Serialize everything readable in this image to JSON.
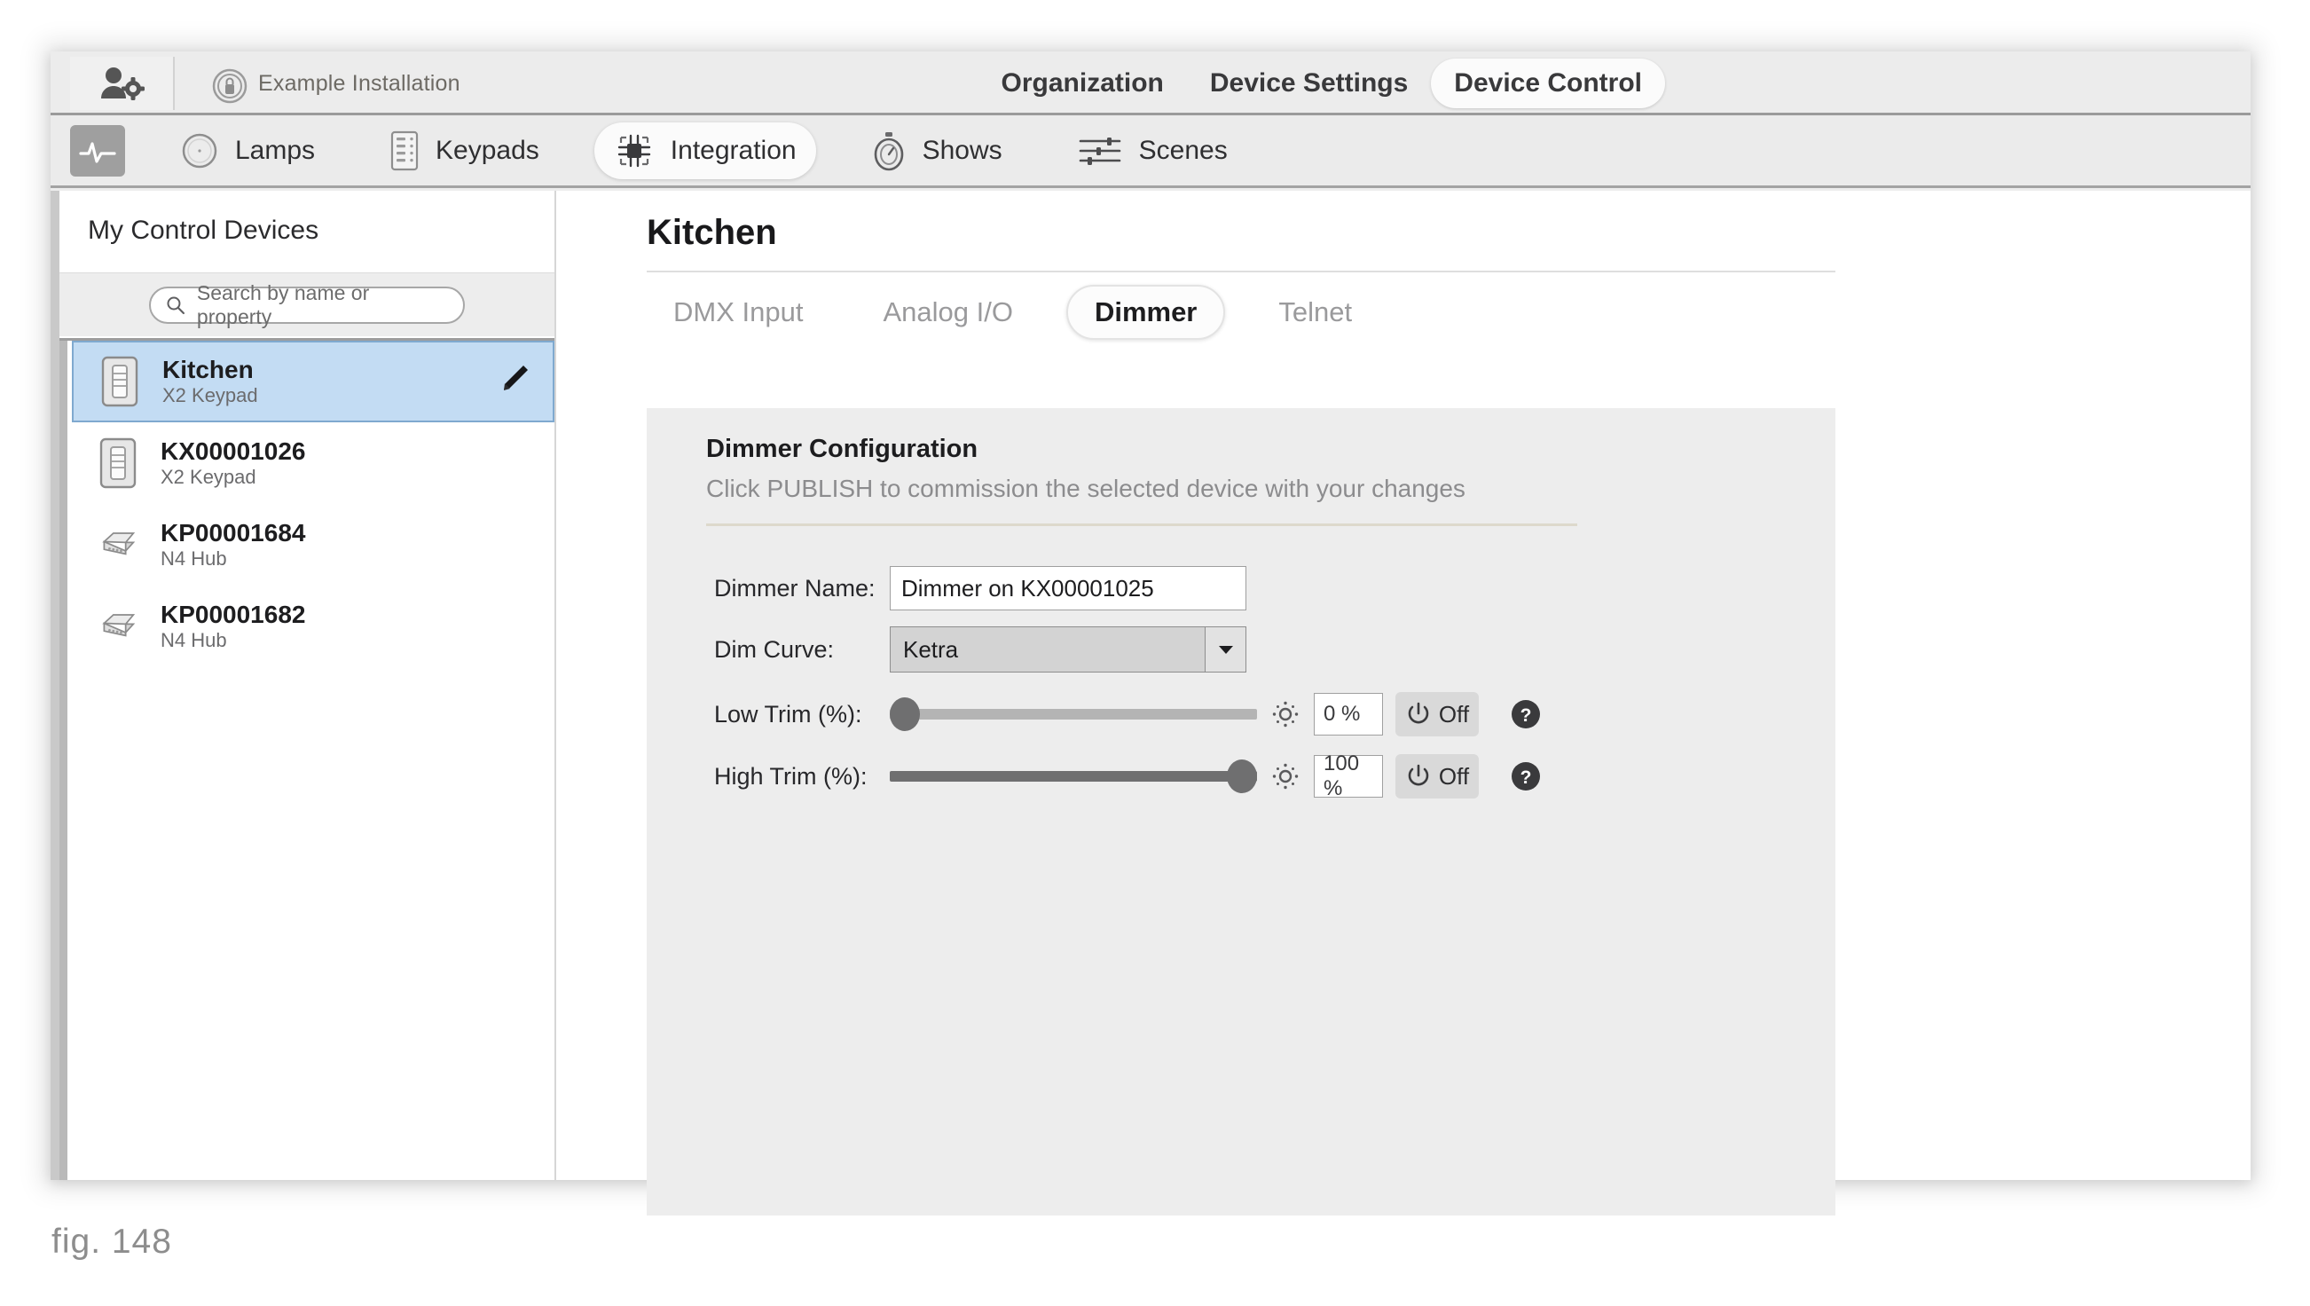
{
  "window": {
    "topbar": {
      "user_settings_icon": "user-gear-icon",
      "installation_lock_icon": "lock-ring-icon",
      "installation_label": "Example Installation",
      "nav_items": [
        {
          "label": "Organization",
          "active": false
        },
        {
          "label": "Device Settings",
          "active": false
        },
        {
          "label": "Device Control",
          "active": true
        }
      ]
    },
    "toolbar": {
      "activity_icon": "activity-pulse-icon",
      "tabs": [
        {
          "label": "Lamps",
          "icon": "lamp-circle-icon",
          "active": false
        },
        {
          "label": "Keypads",
          "icon": "keypad-icon",
          "active": false
        },
        {
          "label": "Integration",
          "icon": "integration-chip-icon",
          "active": true
        },
        {
          "label": "Shows",
          "icon": "stopwatch-icon",
          "active": false
        },
        {
          "label": "Scenes",
          "icon": "sliders-icon",
          "active": false
        }
      ]
    }
  },
  "sidebar": {
    "title": "My Control Devices",
    "search": {
      "placeholder": "Search by name or property",
      "icon": "search-icon",
      "value": ""
    },
    "devices": [
      {
        "name": "Kitchen",
        "type": "X2 Keypad",
        "icon": "keypad-device-icon",
        "selected": true,
        "edit_icon": "pencil-icon"
      },
      {
        "name": "KX00001026",
        "type": "X2 Keypad",
        "icon": "keypad-device-icon",
        "selected": false,
        "edit_icon": ""
      },
      {
        "name": "KP00001684",
        "type": "N4 Hub",
        "icon": "hub-device-icon",
        "selected": false,
        "edit_icon": ""
      },
      {
        "name": "KP00001682",
        "type": "N4 Hub",
        "icon": "hub-device-icon",
        "selected": false,
        "edit_icon": ""
      }
    ]
  },
  "content": {
    "title": "Kitchen",
    "tabs": [
      {
        "label": "DMX Input",
        "active": false
      },
      {
        "label": "Analog I/O",
        "active": false
      },
      {
        "label": "Dimmer",
        "active": true
      },
      {
        "label": "Telnet",
        "active": false
      }
    ],
    "panel": {
      "heading": "Dimmer Configuration",
      "subheading": "Click PUBLISH to commission the selected device with your changes",
      "fields": {
        "name_label": "Dimmer Name:",
        "name_value": "Dimmer on KX00001025",
        "curve_label": "Dim Curve:",
        "curve_value": "Ketra",
        "curve_arrow_icon": "chevron-down-icon",
        "low_trim_label": "Low Trim (%):",
        "low_trim_value": "0 %",
        "low_trim_percent": 0,
        "low_trim_power_label": "Off",
        "high_trim_label": "High Trim (%):",
        "high_trim_value": "100 %",
        "high_trim_percent": 100,
        "high_trim_power_label": "Off",
        "brightness_icon": "brightness-icon",
        "power_icon": "power-icon",
        "help_icon": "help-circle-icon"
      }
    }
  },
  "figure": {
    "caption": "fig. 148"
  },
  "colors": {
    "selection_blue": "#c3dcf3",
    "selection_border": "#7fa9cf",
    "panel_gray": "#ededed",
    "divider_tan": "#ddd9cc"
  }
}
